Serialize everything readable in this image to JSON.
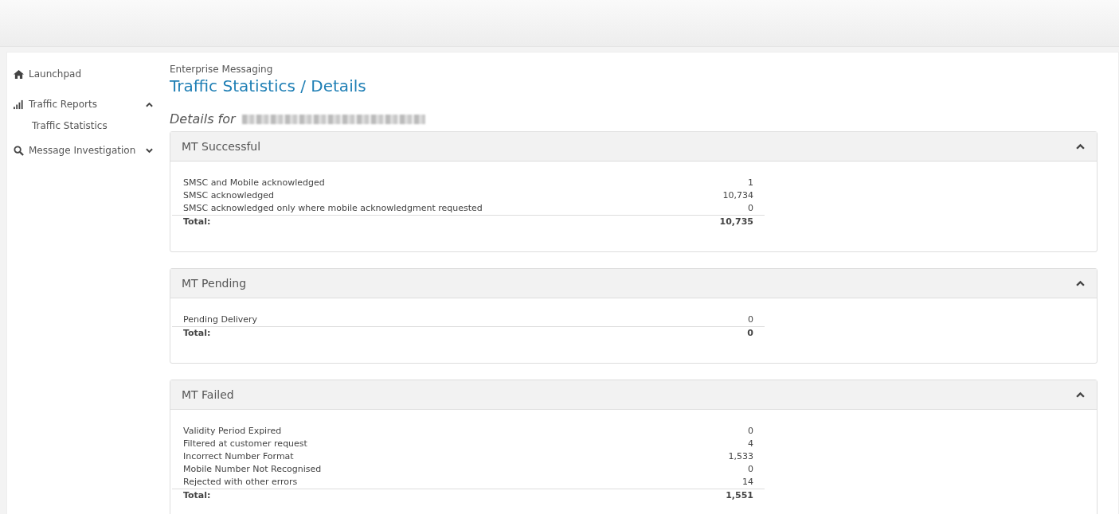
{
  "sidebar": {
    "items": [
      {
        "label": "Launchpad"
      },
      {
        "label": "Traffic Reports",
        "expanded": true,
        "children": [
          {
            "label": "Traffic Statistics"
          }
        ]
      },
      {
        "label": "Message Investigation",
        "expanded": false
      }
    ]
  },
  "breadcrumb": "Enterprise Messaging",
  "title": "Traffic Statistics / Details",
  "details_label": "Details for",
  "panels": [
    {
      "title": "MT Successful",
      "expanded": true,
      "rows": [
        {
          "label": "SMSC and Mobile acknowledged",
          "value": "1"
        },
        {
          "label": "SMSC acknowledged",
          "value": "10,734"
        },
        {
          "label": "SMSC acknowledged only where mobile acknowledgment requested",
          "value": "0"
        }
      ],
      "total": {
        "label": "Total:",
        "value": "10,735"
      }
    },
    {
      "title": "MT Pending",
      "expanded": true,
      "rows": [
        {
          "label": "Pending Delivery",
          "value": "0"
        }
      ],
      "total": {
        "label": "Total:",
        "value": "0"
      }
    },
    {
      "title": "MT Failed",
      "expanded": true,
      "rows": [
        {
          "label": "Validity Period Expired",
          "value": "0"
        },
        {
          "label": "Filtered at customer request",
          "value": "4"
        },
        {
          "label": "Incorrect Number Format",
          "value": "1,533"
        },
        {
          "label": "Mobile Number Not Recognised",
          "value": "0"
        },
        {
          "label": "Rejected with other errors",
          "value": "14"
        }
      ],
      "total": {
        "label": "Total:",
        "value": "1,551"
      }
    }
  ]
}
